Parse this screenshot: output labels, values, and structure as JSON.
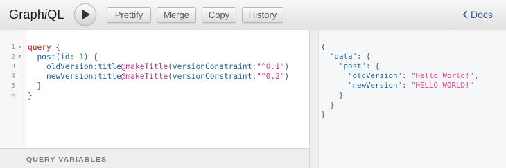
{
  "topbar": {
    "title_start": "Graph",
    "title_italic": "i",
    "title_end": "QL",
    "run_icon": "play-icon",
    "buttons": [
      "Prettify",
      "Merge",
      "Copy",
      "History"
    ],
    "docs_label": "Docs",
    "docs_icon": "chevron-left-icon"
  },
  "editor": {
    "line_numbers": [
      "1",
      "2",
      "3",
      "4",
      "5",
      "6"
    ],
    "lines": [
      [
        {
          "t": "query",
          "c": "kw"
        },
        {
          "t": " {",
          "c": "punc"
        }
      ],
      [
        {
          "t": "  ",
          "c": "punc"
        },
        {
          "t": "post",
          "c": "prop"
        },
        {
          "t": "(",
          "c": "punc"
        },
        {
          "t": "id",
          "c": "attr"
        },
        {
          "t": ": ",
          "c": "punc"
        },
        {
          "t": "1",
          "c": "num"
        },
        {
          "t": ") {",
          "c": "punc"
        }
      ],
      [
        {
          "t": "    ",
          "c": "punc"
        },
        {
          "t": "oldVersion",
          "c": "prop"
        },
        {
          "t": ":",
          "c": "punc"
        },
        {
          "t": "title",
          "c": "prop"
        },
        {
          "t": "@makeTitle",
          "c": "dir"
        },
        {
          "t": "(",
          "c": "punc"
        },
        {
          "t": "versionConstraint",
          "c": "attr"
        },
        {
          "t": ":",
          "c": "punc"
        },
        {
          "t": "\"^0.1\"",
          "c": "str"
        },
        {
          "t": ")",
          "c": "punc"
        }
      ],
      [
        {
          "t": "    ",
          "c": "punc"
        },
        {
          "t": "newVersion",
          "c": "prop"
        },
        {
          "t": ":",
          "c": "punc"
        },
        {
          "t": "title",
          "c": "prop"
        },
        {
          "t": "@makeTitle",
          "c": "dir"
        },
        {
          "t": "(",
          "c": "punc"
        },
        {
          "t": "versionConstraint",
          "c": "attr"
        },
        {
          "t": ":",
          "c": "punc"
        },
        {
          "t": "\"^0.2\"",
          "c": "str"
        },
        {
          "t": ")",
          "c": "punc"
        }
      ],
      [
        {
          "t": "  }",
          "c": "punc"
        }
      ],
      [
        {
          "t": "}",
          "c": "punc"
        }
      ]
    ],
    "variables_label": "QUERY VARIABLES"
  },
  "result": {
    "lines": [
      [
        {
          "t": "{",
          "c": ""
        }
      ],
      [
        {
          "t": "  ",
          "c": ""
        },
        {
          "t": "\"data\"",
          "c": "k"
        },
        {
          "t": ": {",
          "c": ""
        }
      ],
      [
        {
          "t": "    ",
          "c": ""
        },
        {
          "t": "\"post\"",
          "c": "k"
        },
        {
          "t": ": {",
          "c": ""
        }
      ],
      [
        {
          "t": "      ",
          "c": ""
        },
        {
          "t": "\"oldVersion\"",
          "c": "k"
        },
        {
          "t": ": ",
          "c": ""
        },
        {
          "t": "\"Hello World!\"",
          "c": "s"
        },
        {
          "t": ",",
          "c": ""
        }
      ],
      [
        {
          "t": "      ",
          "c": ""
        },
        {
          "t": "\"newVersion\"",
          "c": "k"
        },
        {
          "t": ": ",
          "c": ""
        },
        {
          "t": "\"HELLO WORLD!\"",
          "c": "s"
        }
      ],
      [
        {
          "t": "    }",
          "c": ""
        }
      ],
      [
        {
          "t": "  }",
          "c": ""
        }
      ],
      [
        {
          "t": "}",
          "c": ""
        }
      ]
    ]
  }
}
